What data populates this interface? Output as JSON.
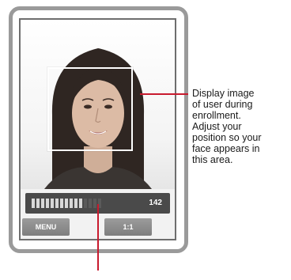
{
  "screen": {
    "enrollment_progress": 0.72,
    "count_value": "142",
    "menu_label": "MENU",
    "ratio_label": "1:1"
  },
  "callout": {
    "text": "Display image\nof user during\nenrollment.\nAdjust your\nposition so your\nface appears in\nthis area."
  },
  "colors": {
    "bezel": "#9a9a9a",
    "callout_line": "#c81a2e",
    "status_bar": "#4a4a4a"
  }
}
